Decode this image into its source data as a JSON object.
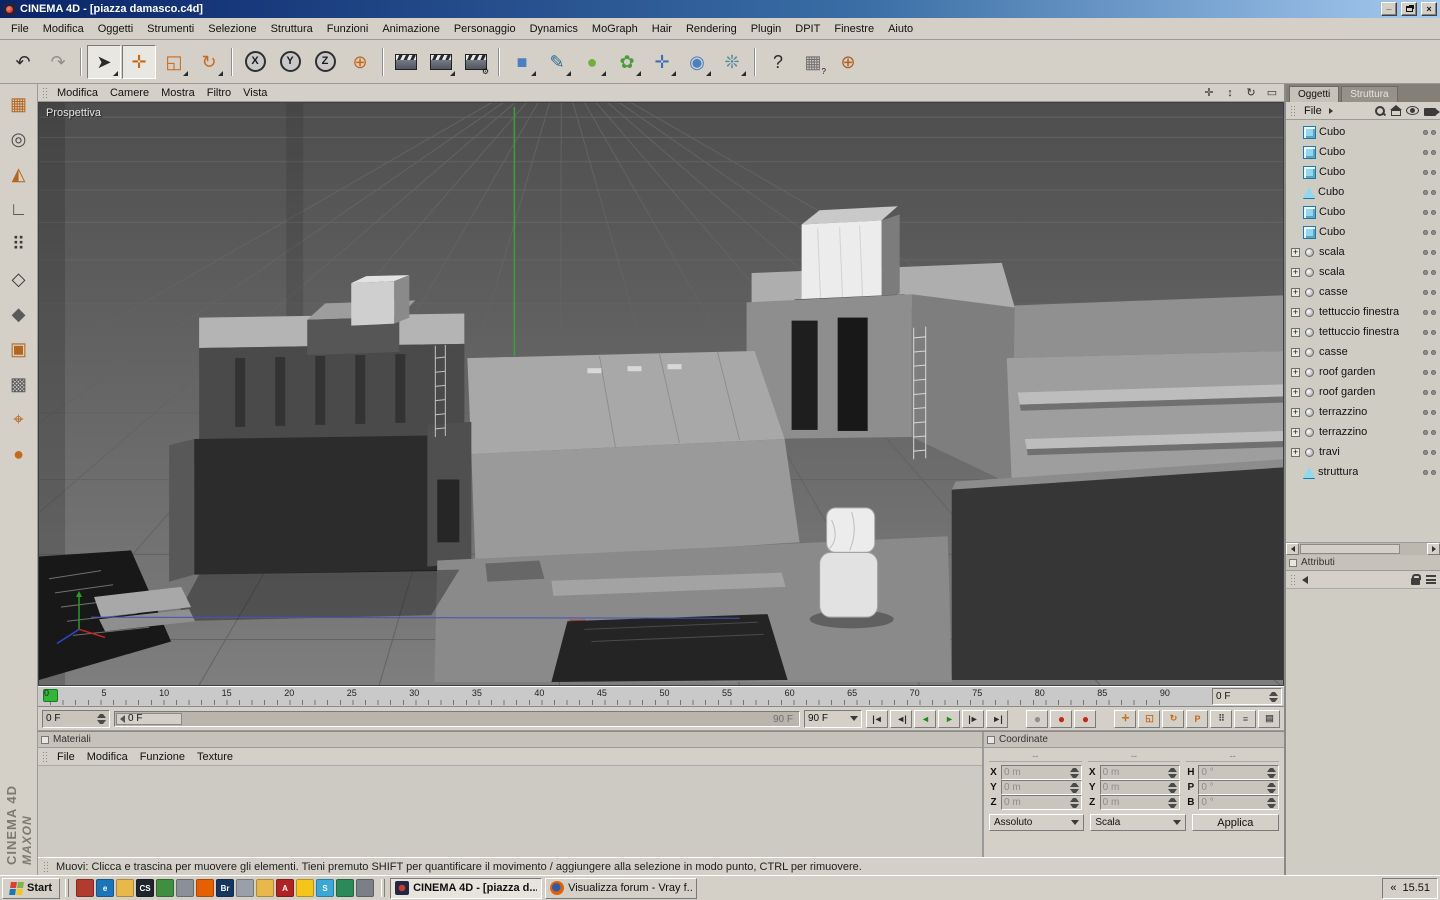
{
  "window": {
    "title": "CINEMA 4D - [piazza damasco.c4d]",
    "minimize_glyph": "_",
    "close_glyph": "×"
  },
  "menubar": [
    "File",
    "Modifica",
    "Oggetti",
    "Strumenti",
    "Selezione",
    "Struttura",
    "Funzioni",
    "Animazione",
    "Personaggio",
    "Dynamics",
    "MoGraph",
    "Hair",
    "Rendering",
    "Plugin",
    "DPIT",
    "Finestre",
    "Aiuto"
  ],
  "toolbar": {
    "history": [
      {
        "name": "undo-button",
        "glyph": "↶",
        "color": "#2d2d2d",
        "class": "",
        "badge": ""
      },
      {
        "name": "redo-button",
        "glyph": "↷",
        "color": "#2d2d2d",
        "class": "disabled",
        "badge": ""
      }
    ],
    "tools": [
      {
        "name": "live-selection-button",
        "glyph": "➤",
        "color": "#2a2a2a",
        "class": "pressed sub",
        "badge": ""
      },
      {
        "name": "move-tool-button",
        "glyph": "✛",
        "color": "#c56a1b",
        "class": "pressed",
        "badge": ""
      },
      {
        "name": "scale-tool-button",
        "glyph": "◱",
        "color": "#c56a1b",
        "class": "sub",
        "badge": ""
      },
      {
        "name": "rotate-tool-button",
        "glyph": "↻",
        "color": "#c56a1b",
        "class": "sub",
        "badge": ""
      }
    ],
    "axes": [
      {
        "name": "lock-x-axis-button",
        "glyph": "X",
        "color": "#1a1a1a",
        "class": "axis",
        "badge": ""
      },
      {
        "name": "lock-y-axis-button",
        "glyph": "Y",
        "color": "#1a1a1a",
        "class": "axis",
        "badge": ""
      },
      {
        "name": "lock-z-axis-button",
        "glyph": "Z",
        "color": "#1a1a1a",
        "class": "axis",
        "badge": ""
      },
      {
        "name": "coordinate-system-button",
        "glyph": "⊕",
        "color": "#c56a1b",
        "class": "",
        "badge": ""
      }
    ],
    "render": [
      {
        "name": "render-view-button",
        "glyph": "",
        "color": "#333",
        "class": "clap",
        "badge": ""
      },
      {
        "name": "render-picture-viewer-button",
        "glyph": "",
        "color": "#333",
        "class": "clap sub",
        "badge": ""
      },
      {
        "name": "render-settings-button",
        "glyph": "",
        "color": "#333",
        "class": "clap",
        "badge": "⚙"
      }
    ],
    "create": [
      {
        "name": "add-cube-button",
        "glyph": "■",
        "color": "#4a7fc1",
        "class": "sub",
        "badge": ""
      },
      {
        "name": "add-spline-button",
        "glyph": "✎",
        "color": "#2a6a8a",
        "class": "sub",
        "badge": ""
      },
      {
        "name": "add-hypernurbs-button",
        "glyph": "●",
        "color": "#6fae3f",
        "class": "sub",
        "badge": ""
      },
      {
        "name": "add-modeling-button",
        "glyph": "✿",
        "color": "#4f9b3f",
        "class": "sub",
        "badge": ""
      },
      {
        "name": "add-deformer-button",
        "glyph": "✛",
        "color": "#3f6fb5",
        "class": "sub",
        "badge": ""
      },
      {
        "name": "add-environment-button",
        "glyph": "◉",
        "color": "#4a7fc1",
        "class": "sub",
        "badge": ""
      },
      {
        "name": "add-particles-button",
        "glyph": "❊",
        "color": "#5a8a9a",
        "class": "sub",
        "badge": ""
      }
    ],
    "help": [
      {
        "name": "help-button",
        "glyph": "?",
        "color": "#2d2d2d",
        "class": "",
        "badge": ""
      },
      {
        "name": "content-browser-button",
        "glyph": "▦",
        "color": "#6e6e6e",
        "class": "",
        "badge": "?"
      },
      {
        "name": "online-updater-button",
        "glyph": "⊕",
        "color": "#b06020",
        "class": "",
        "badge": ""
      }
    ]
  },
  "mode_toolbar": [
    {
      "name": "make-editable-button",
      "glyph": "▦",
      "color": "#b5651d"
    },
    {
      "name": "model-mode-button",
      "glyph": "◎",
      "color": "#4a4a4a"
    },
    {
      "name": "texture-axis-mode-button",
      "glyph": "◭",
      "color": "#b5651d"
    },
    {
      "name": "workplane-mode-button",
      "glyph": "∟",
      "color": "#4a4a4a"
    },
    {
      "name": "points-mode-button",
      "glyph": "⠿",
      "color": "#3a3a3a"
    },
    {
      "name": "edges-mode-button",
      "glyph": "◇",
      "color": "#3a3a3a"
    },
    {
      "name": "polygons-mode-button",
      "glyph": "◆",
      "color": "#5a5a5a"
    },
    {
      "name": "animation-mode-button",
      "glyph": "▣",
      "color": "#b5651d"
    },
    {
      "name": "texture-mode-button",
      "glyph": "▩",
      "color": "#5a5a5a"
    },
    {
      "name": "object-axis-mode-button",
      "glyph": "⌖",
      "color": "#b5651d"
    },
    {
      "name": "kinematics-mode-button",
      "glyph": "●",
      "color": "#c56a1b"
    }
  ],
  "branding": {
    "brand": "MAXON",
    "product": "CINEMA 4D"
  },
  "viewport": {
    "menu": [
      "Modifica",
      "Camere",
      "Mostra",
      "Filtro",
      "Vista"
    ],
    "view_label": "Prospettiva",
    "view_controls": [
      {
        "name": "pan-view-icon",
        "glyph": "✛"
      },
      {
        "name": "zoom-view-icon",
        "glyph": "↕"
      },
      {
        "name": "rotate-view-icon",
        "glyph": "↻"
      },
      {
        "name": "maximize-view-icon",
        "glyph": "▭"
      }
    ]
  },
  "timeline": {
    "tick_labels": [
      "0",
      "5",
      "10",
      "15",
      "20",
      "25",
      "30",
      "35",
      "40",
      "45",
      "50",
      "55",
      "60",
      "65",
      "70",
      "75",
      "80",
      "85",
      "90"
    ],
    "ruler_frame_field": "0 F",
    "current_frame_field": "0 F",
    "range_start_label": "0 F",
    "range_end_label": "90 F",
    "range_dropdown": "90 F",
    "playback": [
      {
        "name": "goto-start-button",
        "glyph": "|◄",
        "color": "#2d2d2d"
      },
      {
        "name": "previous-frame-button",
        "glyph": "◄|",
        "color": "#2d2d2d"
      },
      {
        "name": "play-backward-button",
        "glyph": "◄",
        "color": "#1c8a1c"
      },
      {
        "name": "play-forward-button",
        "glyph": "►",
        "color": "#1c8a1c"
      },
      {
        "name": "next-frame-button",
        "glyph": "|►",
        "color": "#2d2d2d"
      },
      {
        "name": "goto-end-button",
        "glyph": "►|",
        "color": "#2d2d2d"
      }
    ],
    "record": [
      {
        "name": "record-keyframe-button",
        "glyph": "●",
        "color": "#8f8f8f"
      },
      {
        "name": "autokeying-button",
        "glyph": "●",
        "color": "#c22a1a"
      },
      {
        "name": "keyframe-selection-button",
        "glyph": "●",
        "color": "#c22a1a"
      }
    ],
    "key_toggles": [
      {
        "name": "record-position-button",
        "glyph": "✛",
        "color": "#c56a1b"
      },
      {
        "name": "record-scale-button",
        "glyph": "◱",
        "color": "#c56a1b"
      },
      {
        "name": "record-rotation-button",
        "glyph": "↻",
        "color": "#c56a1b"
      },
      {
        "name": "record-parameter-button",
        "glyph": "P",
        "color": "#c56a1b"
      },
      {
        "name": "record-pla-button",
        "glyph": "⠿",
        "color": "#555555"
      },
      {
        "name": "record-options-button",
        "glyph": "≡",
        "color": "#555555"
      },
      {
        "name": "timeline-settings-button",
        "glyph": "▤",
        "color": "#555555"
      }
    ]
  },
  "materials": {
    "title": "Materiali",
    "menu": [
      "File",
      "Modifica",
      "Funzione",
      "Texture"
    ]
  },
  "coordinates": {
    "title": "Coordinate",
    "column_headers": [
      "--",
      "--",
      "--"
    ],
    "rows": [
      {
        "pl": "X",
        "pv": "0 m",
        "sl": "X",
        "sv": "0 m",
        "rl": "H",
        "rv": "0 °"
      },
      {
        "pl": "Y",
        "pv": "0 m",
        "sl": "Y",
        "sv": "0 m",
        "rl": "P",
        "rv": "0 °"
      },
      {
        "pl": "Z",
        "pv": "0 m",
        "sl": "Z",
        "sv": "0 m",
        "rl": "B",
        "rv": "0 °"
      }
    ],
    "mode_dropdown": "Assoluto",
    "scale_dropdown": "Scala",
    "apply_button": "Applica"
  },
  "object_manager": {
    "tabs": [
      {
        "label": "Oggetti",
        "class": "active"
      },
      {
        "label": "Struttura",
        "class": ""
      }
    ],
    "menu_label": "File",
    "objects": [
      {
        "label": "Cubo",
        "icon_class": "icon-cube",
        "icon_name": "cube-object-icon",
        "row_class": ""
      },
      {
        "label": "Cubo",
        "icon_class": "icon-cube",
        "icon_name": "cube-object-icon",
        "row_class": ""
      },
      {
        "label": "Cubo",
        "icon_class": "icon-cube",
        "icon_name": "cube-object-icon",
        "row_class": ""
      },
      {
        "label": "Cubo",
        "icon_class": "icon-poly",
        "icon_name": "polygon-object-icon",
        "row_class": ""
      },
      {
        "label": "Cubo",
        "icon_class": "icon-cube",
        "icon_name": "cube-object-icon",
        "row_class": ""
      },
      {
        "label": "Cubo",
        "icon_class": "icon-cube",
        "icon_name": "cube-object-icon",
        "row_class": ""
      },
      {
        "label": "scala",
        "icon_class": "icon-null",
        "icon_name": "null-object-icon",
        "row_class": "has-exp"
      },
      {
        "label": "scala",
        "icon_class": "icon-null",
        "icon_name": "null-object-icon",
        "row_class": "has-exp"
      },
      {
        "label": "casse",
        "icon_class": "icon-null",
        "icon_name": "null-object-icon",
        "row_class": "has-exp"
      },
      {
        "label": "tettuccio finestra",
        "icon_class": "icon-null",
        "icon_name": "null-object-icon",
        "row_class": "has-exp"
      },
      {
        "label": "tettuccio finestra",
        "icon_class": "icon-null",
        "icon_name": "null-object-icon",
        "row_class": "has-exp"
      },
      {
        "label": "casse",
        "icon_class": "icon-null",
        "icon_name": "null-object-icon",
        "row_class": "has-exp"
      },
      {
        "label": "roof garden",
        "icon_class": "icon-null",
        "icon_name": "null-object-icon",
        "row_class": "has-exp"
      },
      {
        "label": "roof garden",
        "icon_class": "icon-null",
        "icon_name": "null-object-icon",
        "row_class": "has-exp"
      },
      {
        "label": "terrazzino",
        "icon_class": "icon-null",
        "icon_name": "null-object-icon",
        "row_class": "has-exp"
      },
      {
        "label": "terrazzino",
        "icon_class": "icon-null",
        "icon_name": "null-object-icon",
        "row_class": "has-exp"
      },
      {
        "label": "travi",
        "icon_class": "icon-null",
        "icon_name": "null-object-icon",
        "row_class": "has-exp"
      },
      {
        "label": "struttura",
        "icon_class": "icon-poly",
        "icon_name": "polygon-object-icon",
        "row_class": ""
      }
    ]
  },
  "attributes": {
    "title": "Attributi"
  },
  "status_bar": "Muovi: Clicca e trascina per muovere gli elementi. Tieni premuto SHIFT per quantificare il movimento / aggiungere alla selezione in modo punto, CTRL per rimuovere.",
  "taskbar": {
    "start_label": "Start",
    "quick_launch": [
      {
        "name": "quicklaunch-mediaplayer-icon",
        "bg": "#b23a2e",
        "glyph": ""
      },
      {
        "name": "quicklaunch-internet-explorer-icon",
        "bg": "#1b75bb",
        "glyph": "e"
      },
      {
        "name": "quicklaunch-folder-icon",
        "bg": "#e8b84b",
        "glyph": ""
      },
      {
        "name": "quicklaunch-photoshop-icon",
        "bg": "#20242c",
        "glyph": "CS"
      },
      {
        "name": "quicklaunch-msn-icon",
        "bg": "#3f8f3f",
        "glyph": ""
      },
      {
        "name": "quicklaunch-mail-icon",
        "bg": "#8a8f98",
        "glyph": ""
      },
      {
        "name": "quicklaunch-firefox-icon",
        "bg": "#e66000",
        "glyph": ""
      },
      {
        "name": "quicklaunch-bridge-icon",
        "bg": "#14375f",
        "glyph": "Br"
      },
      {
        "name": "quicklaunch-winamp-icon",
        "bg": "#9a9fa8",
        "glyph": ""
      },
      {
        "name": "quicklaunch-documents-icon",
        "bg": "#e8b84b",
        "glyph": ""
      },
      {
        "name": "quicklaunch-acrobat-icon",
        "bg": "#b22222",
        "glyph": "A"
      },
      {
        "name": "quicklaunch-messenger-icon",
        "bg": "#f5c518",
        "glyph": ""
      },
      {
        "name": "quicklaunch-skype-icon",
        "bg": "#3aa8d8",
        "glyph": "S"
      },
      {
        "name": "quicklaunch-money-icon",
        "bg": "#2a8a5a",
        "glyph": ""
      },
      {
        "name": "quicklaunch-tools-icon",
        "bg": "#7a7f88",
        "glyph": ""
      }
    ],
    "windows": [
      {
        "label": "CINEMA 4D - [piazza d...",
        "class": "active",
        "icon_class": "ti-c4d",
        "icon_name": "cinema4d-icon"
      },
      {
        "label": "Visualizza forum - Vray f...",
        "class": "",
        "icon_class": "ti-ff",
        "icon_name": "firefox-icon"
      }
    ],
    "tray_chevron": "«",
    "clock": "15.51"
  }
}
